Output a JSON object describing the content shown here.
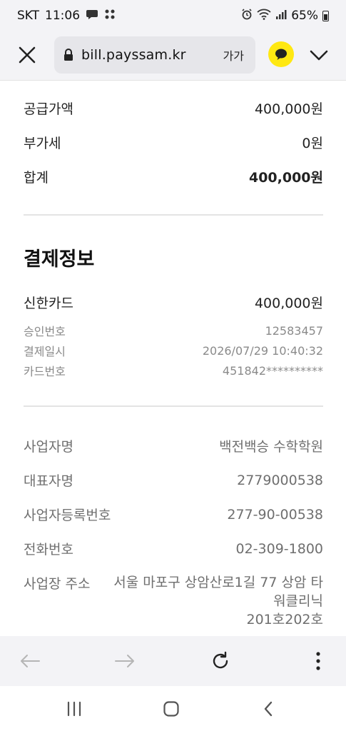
{
  "status_bar": {
    "carrier": "SKT",
    "time": "11:06",
    "battery": "65%"
  },
  "url_bar": {
    "url": "bill.payssam.kr",
    "text_size_label": "가가"
  },
  "summary": {
    "supply_label": "공급가액",
    "supply_value": "400,000원",
    "vat_label": "부가세",
    "vat_value": "0원",
    "total_label": "합계",
    "total_value": "400,000원"
  },
  "payment": {
    "title": "결제정보",
    "card_label": "신한카드",
    "card_amount": "400,000원",
    "approval_label": "승인번호",
    "approval_value": "12583457",
    "datetime_label": "결제일시",
    "datetime_value": "2026/07/29 10:40:32",
    "card_no_label": "카드번호",
    "card_no_value": "451842**********"
  },
  "business": {
    "name_label": "사업자명",
    "name_value": "백전백승 수학학원",
    "rep_label": "대표자명",
    "rep_value": "2779000538",
    "reg_label": "사업자등록번호",
    "reg_value": "277-90-00538",
    "phone_label": "전화번호",
    "phone_value": "02-309-1800",
    "address_label": "사업장 주소",
    "address_line1": "서울 마포구 상암산로1길 77 상암 타",
    "address_line2": "워클리닉",
    "address_line3": "201호202호"
  },
  "icons": {
    "close": "close-icon",
    "lock": "lock-icon",
    "kakao": "kakao-talk-icon",
    "menu": "chevron-down-icon",
    "back": "arrow-left-icon",
    "forward": "arrow-right-icon",
    "reload": "reload-icon",
    "more": "more-vertical-icon",
    "recents": "recent-apps-icon",
    "home": "home-icon",
    "nav_back": "nav-back-icon"
  },
  "colors": {
    "kakao_yellow": "#ffe812",
    "muted_text": "#8a8a8a",
    "bar_bg": "#f3f3f6"
  }
}
